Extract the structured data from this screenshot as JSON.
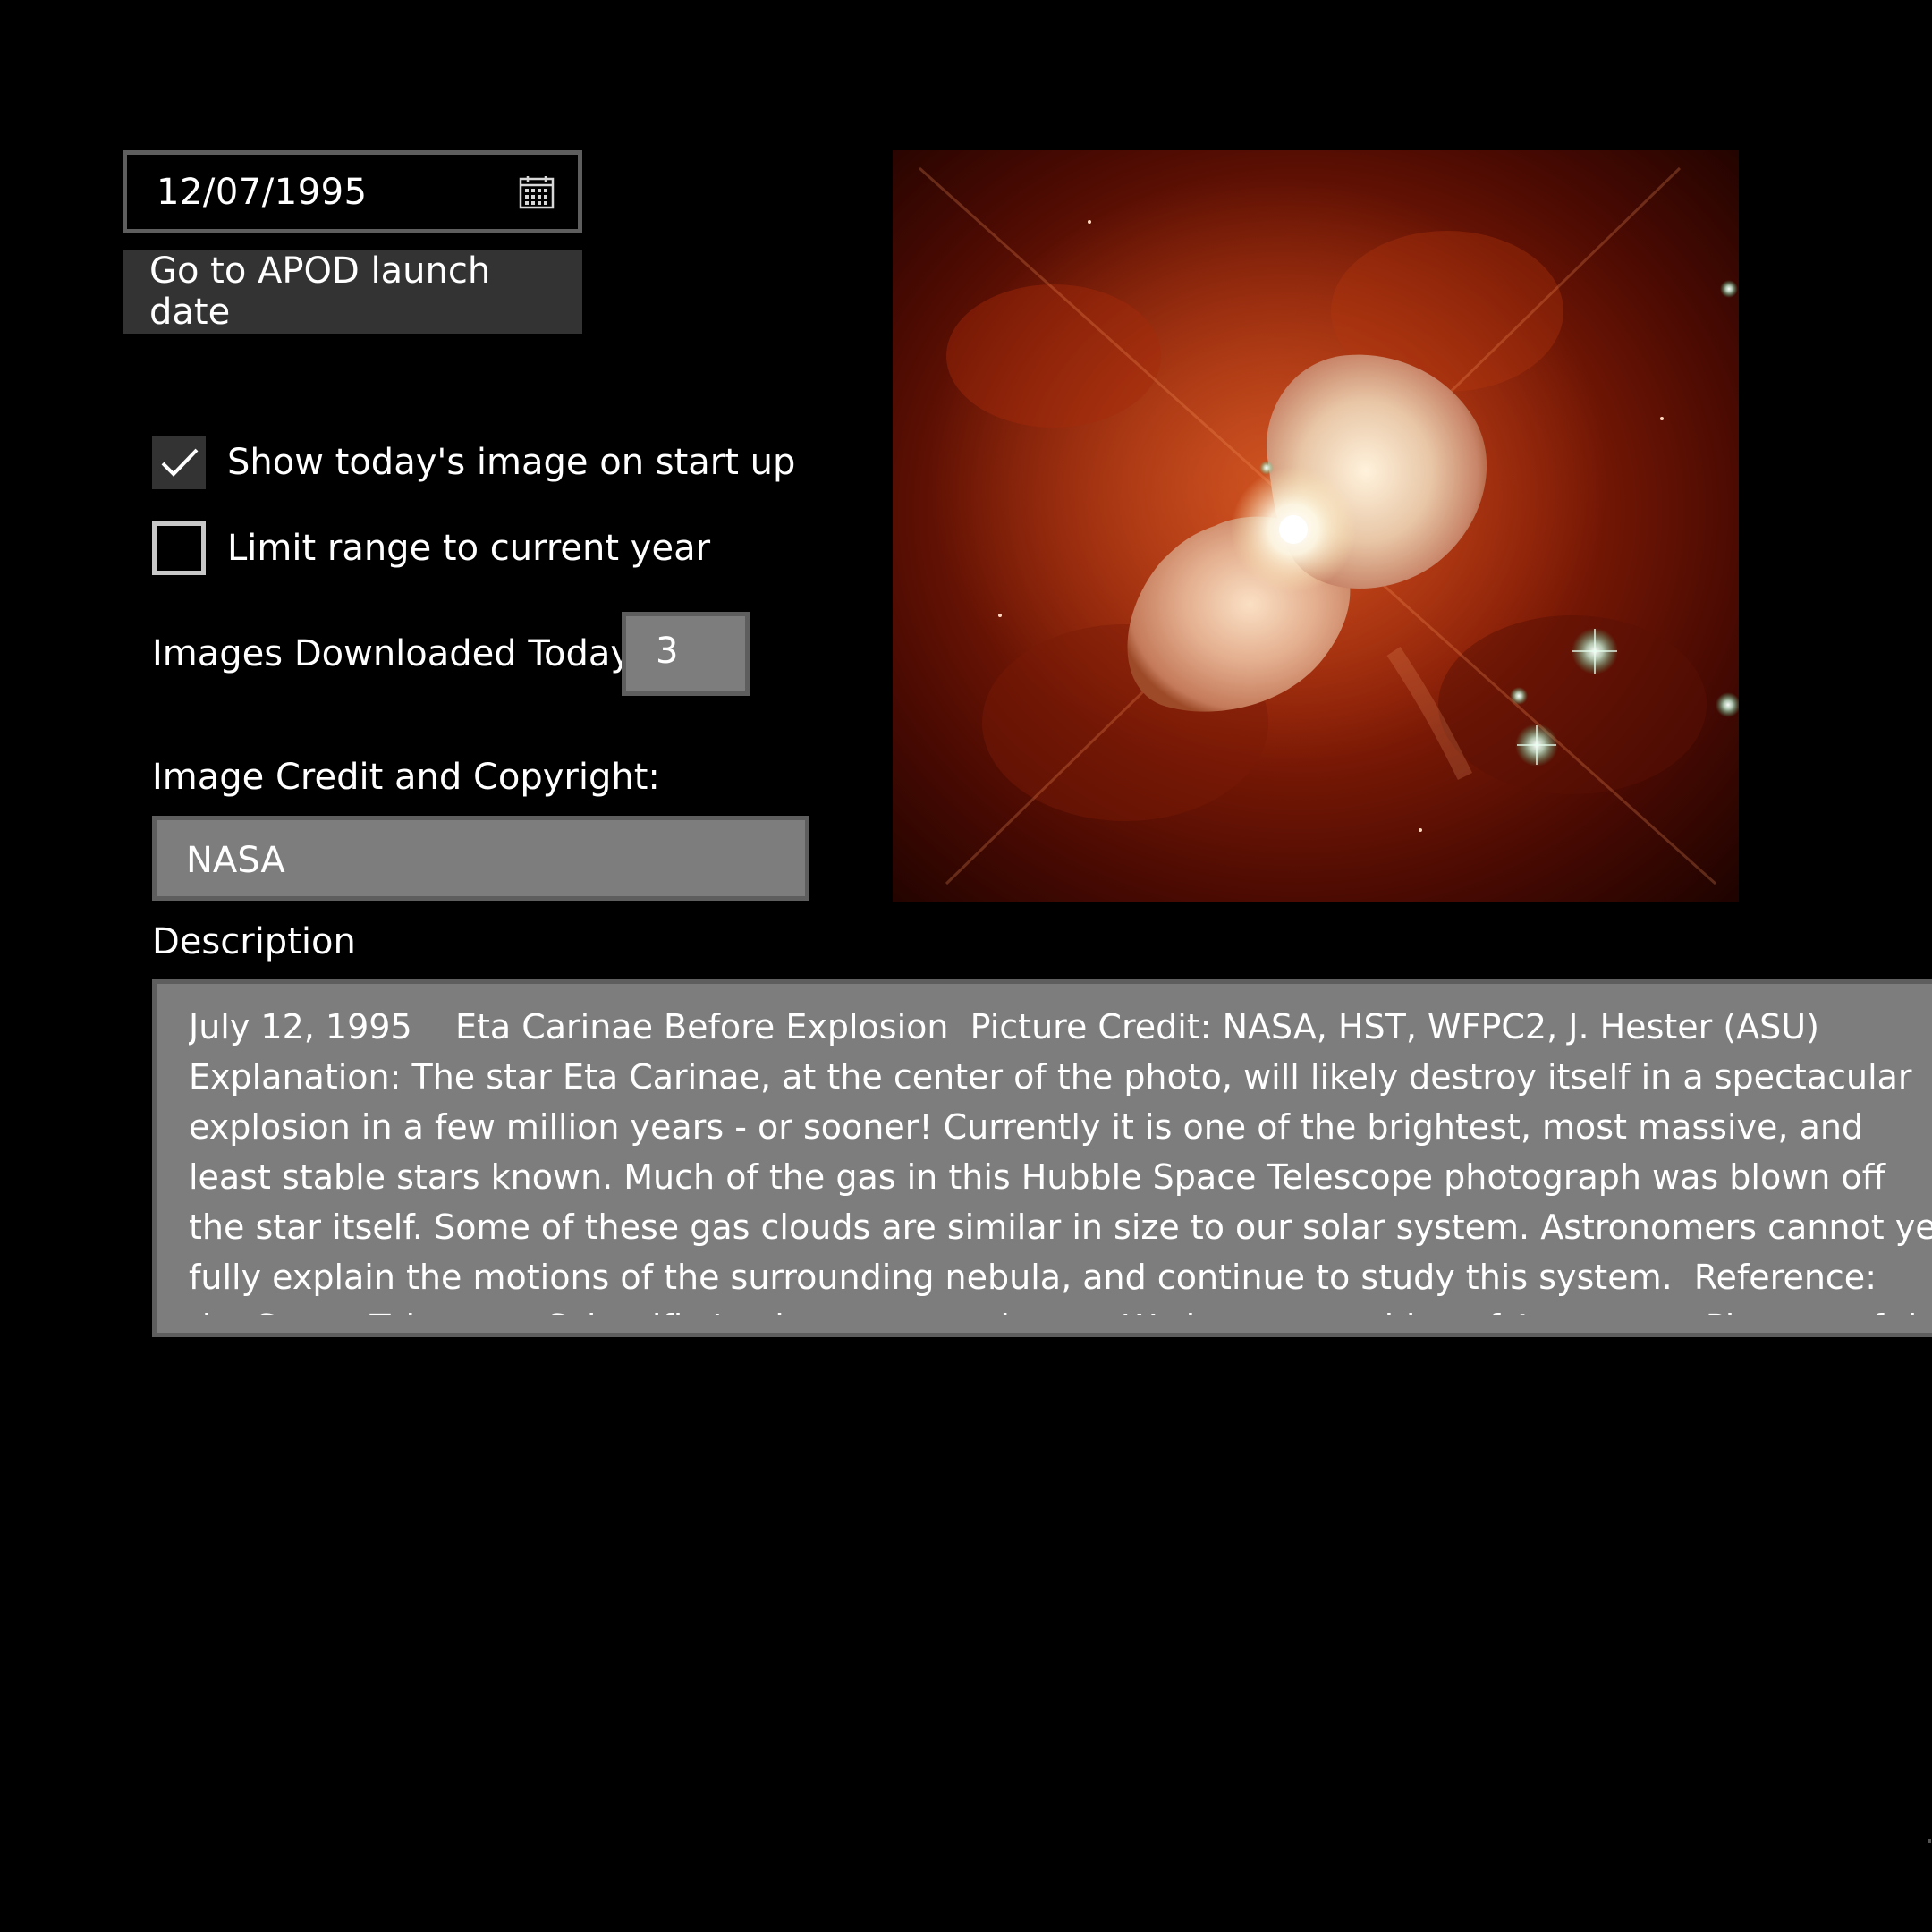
{
  "date_picker": {
    "value": "12/07/1995",
    "icon": "calendar-icon"
  },
  "launch_button": {
    "label": "Go to APOD launch date"
  },
  "options": {
    "show_today": {
      "label": "Show today's image on start up",
      "checked": true
    },
    "limit_range": {
      "label": "Limit range to current year",
      "checked": false
    }
  },
  "downloads": {
    "label": "Images Downloaded Today:",
    "value": "3"
  },
  "credit": {
    "label": "Image Credit and Copyright:",
    "value": "NASA"
  },
  "description": {
    "label": "Description",
    "text": "July 12, 1995    Eta Carinae Before Explosion  Picture Credit: NASA, HST, WFPC2, J. Hester (ASU)  Explanation: The star Eta Carinae, at the center of the photo, will likely destroy itself in a spectacular explosion in a few million years - or sooner! Currently it is one of the brightest, most massive, and least stable stars known. Much of the gas in this Hubble Space Telescope photograph was blown off the star itself. Some of these gas clouds are similar in size to our solar system. Astronomers cannot yet fully explain the motions of the surrounding nebula, and continue to study this system.  Reference:  the Space Telescope Scientific Institute press release.  We keep an archive of Astronomy Pictures of the Day.   Astronomy Picture of the Day is"
  },
  "image": {
    "subject": "Eta Carinae nebula"
  },
  "colors": {
    "background": "#000000",
    "control_fill": "#7d7d7d",
    "control_border": "#5e5e5e",
    "button_fill": "#333333",
    "text": "#ffffff"
  }
}
